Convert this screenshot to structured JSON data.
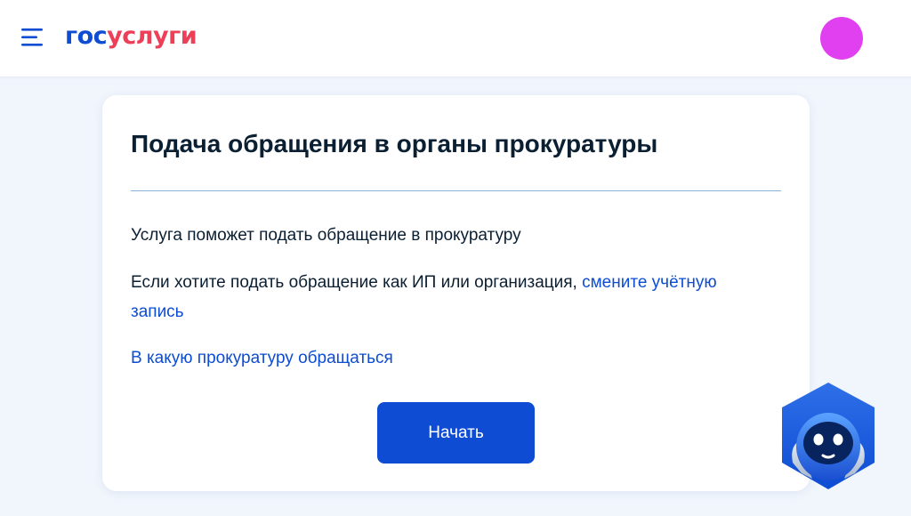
{
  "header": {
    "logo_part1": "гос",
    "logo_part2": "услуги"
  },
  "card": {
    "title": "Подача обращения в органы прокуратуры",
    "intro": "Услуга поможет подать обращение в прокуратуру",
    "account_text": "Если хотите подать обращение как ИП или организация, ",
    "account_link": "смените учётную запись",
    "which_office_link": "В какую прокуратуру обращаться",
    "start_button": "Начать"
  },
  "colors": {
    "brand_blue": "#0d4cd3",
    "brand_red": "#ee3f58",
    "avatar": "#e040f0",
    "background": "#f1f5fc",
    "text": "#0b1f33"
  },
  "icons": {
    "menu": "menu-icon",
    "avatar": "avatar",
    "assistant": "robot-assistant-icon"
  }
}
